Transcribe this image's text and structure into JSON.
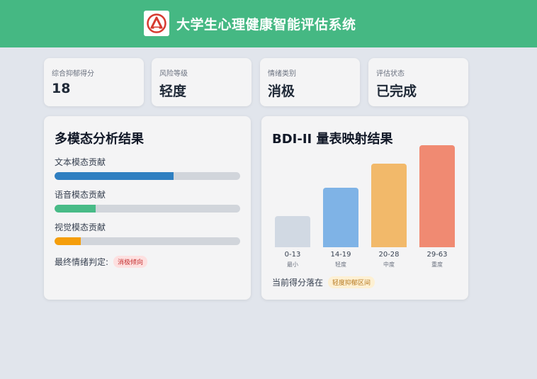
{
  "app": {
    "title": "大学生心理健康智能评估系统",
    "logo_icon": "emblem-icon",
    "header_color": "#45b883"
  },
  "stats": [
    {
      "label": "综合抑郁得分",
      "value": "18"
    },
    {
      "label": "风险等级",
      "value": "轻度"
    },
    {
      "label": "情绪类别",
      "value": "消极"
    },
    {
      "label": "评估状态",
      "value": "已完成"
    }
  ],
  "multimodal": {
    "title": "多模态分析结果",
    "modalities": [
      {
        "label": "文本模态贡献",
        "fraction": 0.64,
        "color": "#2f7fc1"
      },
      {
        "label": "语音模态贡献",
        "fraction": 0.22,
        "color": "#48bb87"
      },
      {
        "label": "视觉模态贡献",
        "fraction": 0.14,
        "color": "#f59e0b"
      }
    ],
    "verdict_label": "最终情绪判定:",
    "verdict_badge": "消极倾向"
  },
  "bdi": {
    "title": "BDI-II 量表映射结果",
    "current_label": "当前得分落在",
    "current_badge": "轻度抑郁区间"
  },
  "chart_data": {
    "type": "bar",
    "categories": [
      "0-13",
      "14-19",
      "20-28",
      "29-63"
    ],
    "sublabels": [
      "最小",
      "轻度",
      "中度",
      "重度"
    ],
    "values": [
      3.0,
      5.7,
      8.0,
      9.8
    ],
    "ylim": [
      0,
      10
    ],
    "colors": [
      "#d1d9e3",
      "#7fb3e6",
      "#f2b96a",
      "#f08a72"
    ],
    "title": "",
    "xlabel": "",
    "ylabel": "",
    "grid": false,
    "legend": "none"
  }
}
